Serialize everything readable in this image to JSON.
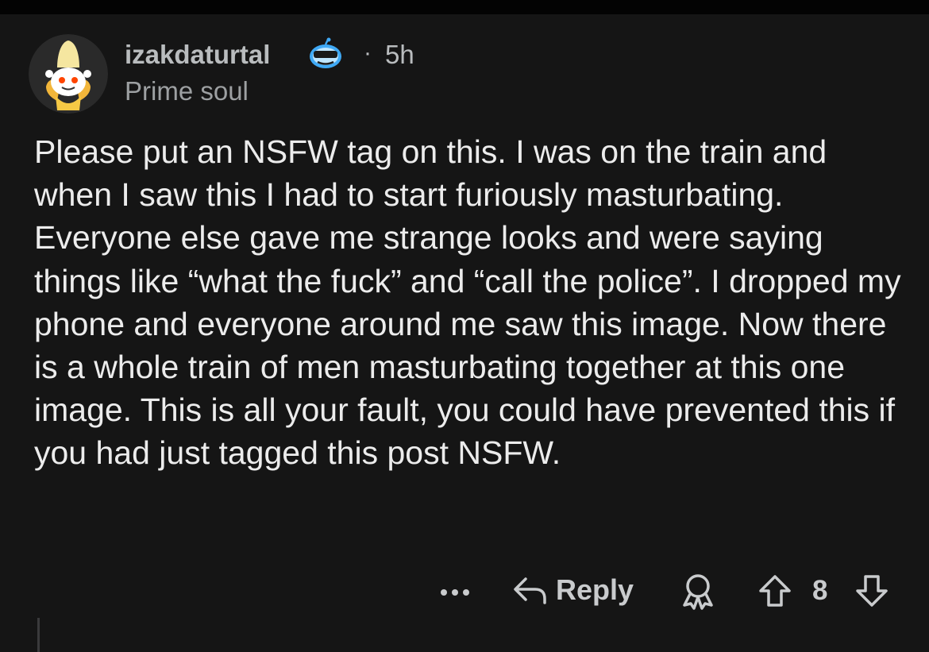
{
  "comment": {
    "username": "izakdaturtal",
    "separator": "·",
    "time_ago": "5h",
    "flair": "Prime soul",
    "body": "Please put an NSFW tag on this. I was on the train and when I saw this I had to start furiously masturbating. Everyone else gave me strange looks and were saying things like “what the fuck” and “call the police”. I dropped my phone and everyone around me saw this image. Now there is a whole train of men masturbating together at this one image. This is all your fault, you could have prevented this if you had just tagged this post NSFW.",
    "avatar_icon": "banana-snoo-avatar",
    "badge_icon": "sunglasses-snoo-badge"
  },
  "actions": {
    "more_icon": "more-dots-icon",
    "reply_icon": "reply-arrow-icon",
    "reply_label": "Reply",
    "award_icon": "award-icon",
    "upvote_icon": "upvote-arrow-icon",
    "vote_count": "8",
    "downvote_icon": "downvote-arrow-icon"
  },
  "colors": {
    "background": "#151515",
    "text_primary": "#ececec",
    "text_secondary": "#b9bcbe",
    "icon": "#c9cbcd",
    "badge_accent": "#3fa9f5"
  }
}
